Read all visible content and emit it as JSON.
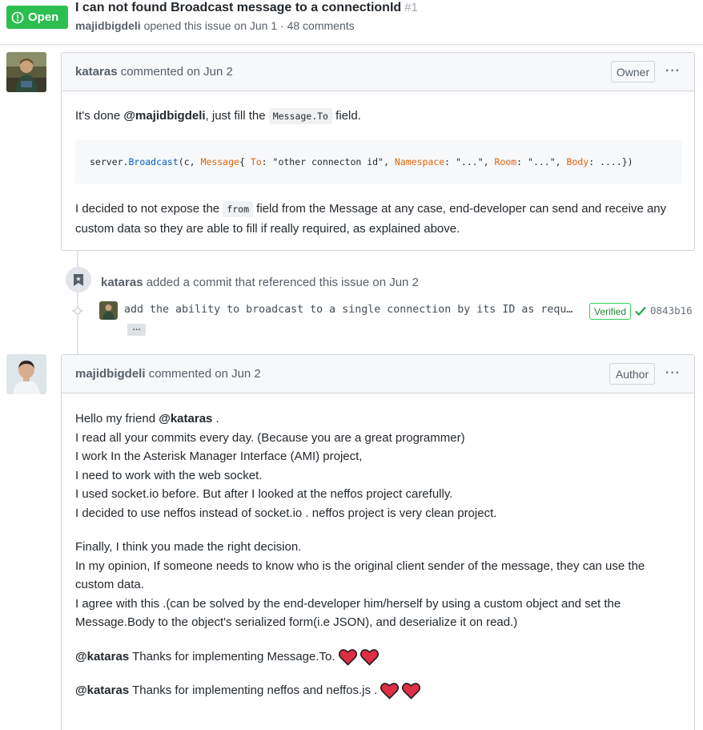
{
  "issue": {
    "status": "Open",
    "title": "I can not found Broadcast message to a connectionId",
    "number": "#1",
    "author": "majidbigdeli",
    "meta_text": "opened this issue on Jun 1 · 48 comments"
  },
  "comment1": {
    "author": "kataras",
    "action": "commented on Jun 2",
    "badge": "Owner",
    "menu": "···",
    "p1_prefix": "It's done ",
    "p1_mention": "@majidbigdeli",
    "p1_mid": ", just fill the ",
    "p1_code": "Message.To",
    "p1_suffix": " field.",
    "code": {
      "t1": "server.",
      "t2": "Broadcast",
      "t3": "(c, ",
      "t4": "Message",
      "t5": "{ ",
      "t6": "To",
      "t7": ": \"other connecton id\", ",
      "t8": "Namespace",
      "t9": ": \"...\", ",
      "t10": "Room",
      "t11": ": \"...\", ",
      "t12": "Body",
      "t13": ": ....})"
    },
    "p2_prefix": "I decided to not expose the ",
    "p2_code": "from",
    "p2_suffix": " field from the Message at any case, end-developer can send and receive any custom data so they are able to fill if really required, as explained above."
  },
  "event": {
    "author": "kataras",
    "text": "added a commit that referenced this issue on Jun 2",
    "commit_message": "add the ability to broadcast to a single connection by its ID as requ…",
    "verified": "Verified",
    "sha": "0843b16",
    "expander": "…"
  },
  "comment2": {
    "author": "majidbigdeli",
    "action": "commented on Jun 2",
    "badge": "Author",
    "menu": "···",
    "l1_prefix": "Hello my friend ",
    "l1_mention": "@kataras",
    "l1_suffix": " .",
    "l2": "I read all your commits every day. (Because you are a great programmer)",
    "l3": "I work In the Asterisk Manager Interface (AMI) project,",
    "l4": "I need to work with the web socket.",
    "l5": "I used socket.io before. But after I looked at the neffos project carefully.",
    "l6": "I decided to use neffos instead of socket.io . neffos project is very clean project.",
    "p2_l1": "Finally, I think you made the right decision.",
    "p2_l2": "In my opinion, If someone needs to know who is the original client sender of the message, they can use the custom data.",
    "p2_l3": "I agree with this .(can be solved by the end-developer him/herself by using a custom object and set the Message.Body to the object's serialized form(i.e JSON), and deserialize it on read.)",
    "p3_mention": "@kataras",
    "p3_text": " Thanks for implementing Message.To.",
    "p4_mention": "@kataras",
    "p4_text": " Thanks for implementing neffos and neffos.js ."
  },
  "colors": {
    "open_green": "#2cbe4e",
    "header_bg": "#f6f8fa",
    "border": "#d1d5da",
    "heart_red": "#dd2e44",
    "verified_green": "#22863a"
  }
}
